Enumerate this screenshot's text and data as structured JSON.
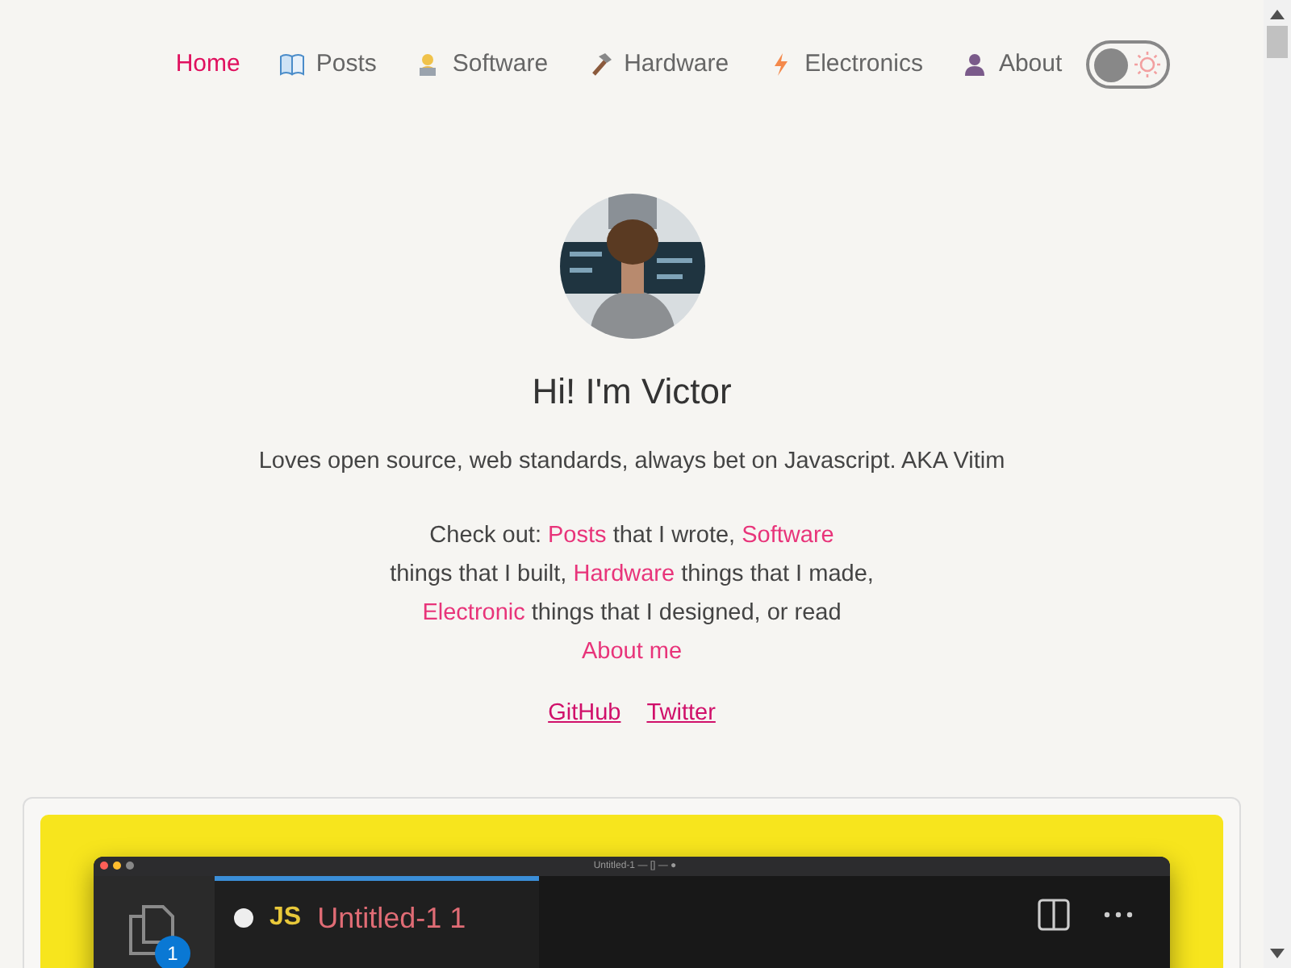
{
  "nav": {
    "items": [
      {
        "label": "Home",
        "kind": "plain",
        "selected": true
      },
      {
        "label": "Posts",
        "kind": "book",
        "selected": false
      },
      {
        "label": "Software",
        "kind": "laptop",
        "selected": false
      },
      {
        "label": "Hardware",
        "kind": "hammer",
        "selected": false
      },
      {
        "label": "Electronics",
        "kind": "bolt",
        "selected": false
      },
      {
        "label": "About",
        "kind": "person",
        "selected": false
      }
    ],
    "theme_toggle": {
      "on": false
    }
  },
  "profile": {
    "heading": "Hi! I'm Victor",
    "tagline": "Loves open source, web standards, always bet on Javascript. AKA Vitim",
    "intro": [
      {
        "text": "Check out:",
        "link": false
      },
      {
        "text": "Posts",
        "link": true
      },
      {
        "text": "that I wrote,",
        "link": false
      },
      {
        "text": "Software",
        "link": true
      },
      {
        "text": "things that I built,",
        "link": false
      },
      {
        "text": "Hardware",
        "link": true
      },
      {
        "text": "things that I",
        "link": false
      },
      {
        "text": "made,",
        "link": false
      },
      {
        "text": "Electronic",
        "link": true
      },
      {
        "text": "things that I designed, or",
        "link": false
      },
      {
        "text": "read",
        "link": false
      },
      {
        "text": "About me",
        "link": true
      }
    ],
    "social_links": [
      "GitHub",
      "Twitter"
    ]
  },
  "featured_card": {
    "editor": {
      "window_title": "Untitled-1 — [] — ●",
      "badge": "1",
      "tab": {
        "language": "JS",
        "name": "Untitled-1 1"
      }
    }
  }
}
